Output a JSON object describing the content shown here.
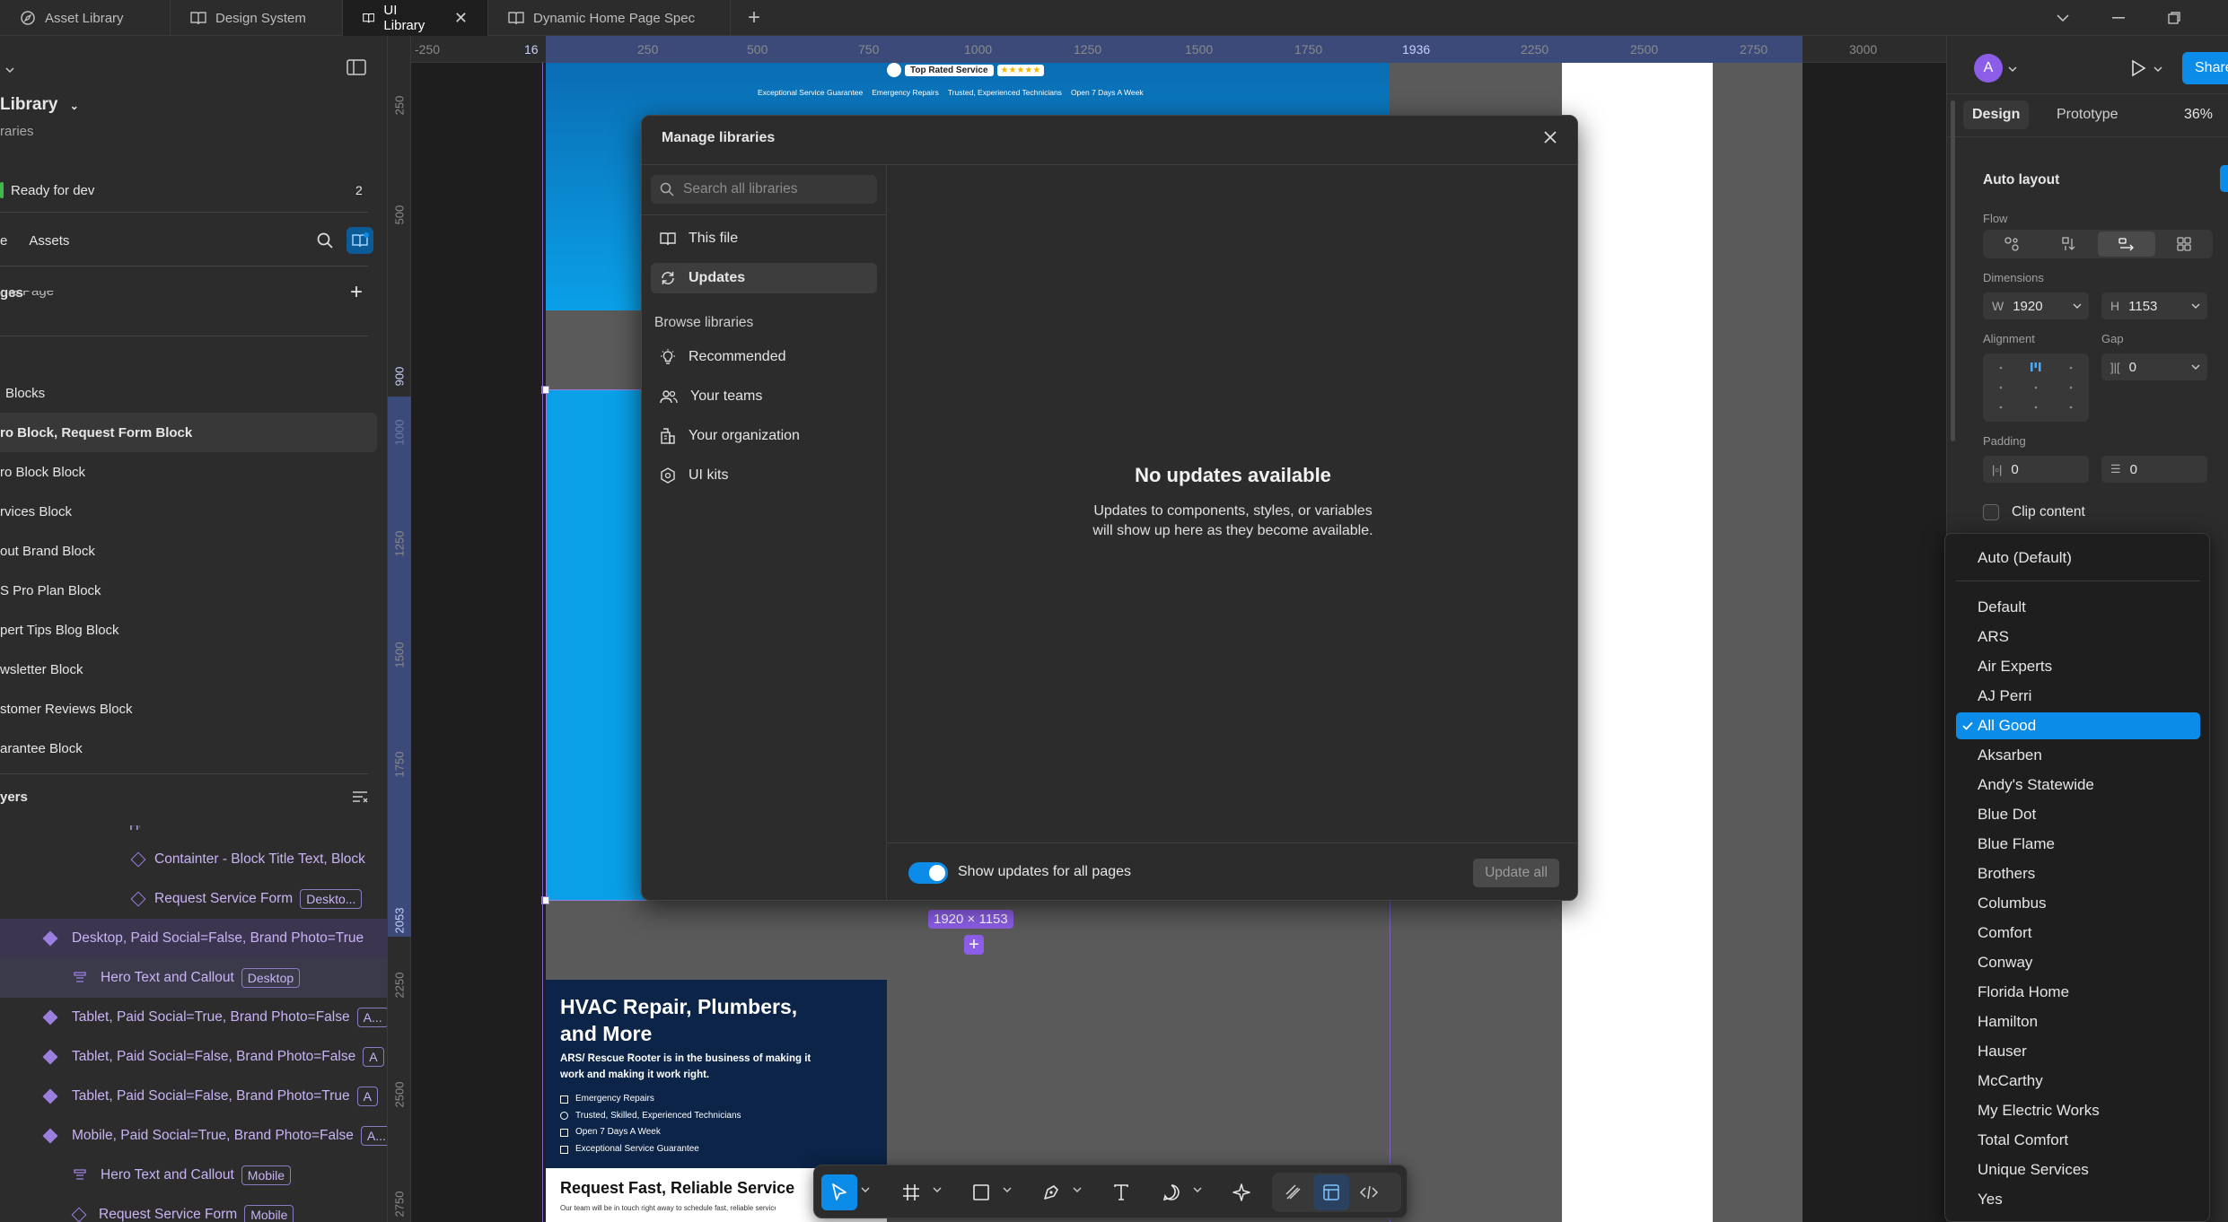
{
  "tabs": [
    {
      "label": "Asset Library",
      "icon": "compass-icon"
    },
    {
      "label": "Design System",
      "icon": "book-icon"
    },
    {
      "label": "UI Library",
      "icon": "book-icon",
      "active": true
    },
    {
      "label": "Dynamic Home Page Spec",
      "icon": "book-icon"
    }
  ],
  "left_panel": {
    "file_title": "Library",
    "file_subtitle": "raries",
    "status": "Ready for dev",
    "status_count": "2",
    "tab_layers": "e",
    "tab_assets": "Assets",
    "pages_header": "ges",
    "pages_partial": "me Page",
    "pages": [
      "Blocks",
      "ro Block, Request Form Block",
      "ro Block Block",
      "rvices Block",
      "out Brand Block",
      "S Pro Plan Block",
      "pert Tips Blog Block",
      "wsletter Block",
      "stomer Reviews Block",
      "arantee Block"
    ],
    "layers_header": "yers",
    "layers_partial": "Hero Block Content",
    "layers": [
      {
        "label": "Containter - Block Title Text, Block",
        "badge": "",
        "kind": "hollow",
        "indent": 1
      },
      {
        "label": "Request Service Form",
        "badge": "Deskto...",
        "kind": "hollow",
        "indent": 1
      },
      {
        "label": "Desktop, Paid Social=False, Brand Photo=True",
        "badge": "",
        "kind": "solid",
        "indent": 0
      },
      {
        "label": "Hero Text and Callout",
        "badge": "Desktop",
        "kind": "stack",
        "indent": 1
      },
      {
        "label": "Tablet, Paid Social=True, Brand Photo=False",
        "badge": "A...",
        "kind": "solid",
        "indent": 0
      },
      {
        "label": "Tablet, Paid Social=False, Brand Photo=False",
        "badge": "A",
        "kind": "solid",
        "indent": 0
      },
      {
        "label": "Tablet, Paid Social=False, Brand Photo=True",
        "badge": "A",
        "kind": "solid",
        "indent": 0
      },
      {
        "label": "Mobile, Paid Social=True, Brand Photo=False",
        "badge": "A...",
        "kind": "solid",
        "indent": 0
      },
      {
        "label": "Hero Text and Callout",
        "badge": "Mobile",
        "kind": "stack",
        "indent": 1
      },
      {
        "label": "Request Service Form",
        "badge": "Mobile",
        "kind": "hollow",
        "indent": 1
      }
    ]
  },
  "ruler": {
    "top": [
      "-250",
      "16",
      "250",
      "500",
      "750",
      "1000",
      "1250",
      "1500",
      "1750",
      "1936",
      "2250",
      "2500",
      "2750",
      "3000"
    ],
    "left": [
      "250",
      "500",
      "900",
      "1000",
      "1250",
      "1500",
      "1750",
      "2053",
      "2250",
      "2500",
      "2750"
    ]
  },
  "canvas": {
    "top_rated": "Top Rated Service",
    "trust_items": [
      "Exceptional Service Guarantee",
      "Emergency Repairs",
      "Trusted, Experienced Technicians",
      "Open 7 Days A Week"
    ],
    "size_label": "1920 × 1153",
    "hero_title": "HVAC Repair, Plumbers, and More",
    "hero_body": "ARS/ Rescue Rooter is in the business of making it work and making it work right.",
    "hero_list": [
      "Emergency Repairs",
      "Trusted, Skilled, Experienced Technicians",
      "Open 7 Days A Week",
      "Exceptional Service Guarantee"
    ],
    "form_title": "Request Fast, Reliable Service",
    "form_sub": "Our team will be in touch right away to schedule fast, reliable service tailored to you"
  },
  "modal": {
    "title": "Manage libraries",
    "search_placeholder": "Search all libraries",
    "nav_this_file": "This file",
    "nav_updates": "Updates",
    "browse_header": "Browse libraries",
    "browse": [
      {
        "label": "Recommended",
        "icon": "lightbulb-icon"
      },
      {
        "label": "Your teams",
        "icon": "people-icon"
      },
      {
        "label": "Your organization",
        "icon": "building-icon"
      },
      {
        "label": "UI kits",
        "icon": "kit-icon"
      }
    ],
    "empty_title": "No updates available",
    "empty_body_1": "Updates to components, styles, or variables",
    "empty_body_2": "will show up here as they become available.",
    "toggle_label": "Show updates for all pages",
    "update_all": "Update all"
  },
  "right_panel": {
    "avatar_letter": "A",
    "share": "Share",
    "tab_design": "Design",
    "tab_prototype": "Prototype",
    "zoom": "36%",
    "auto_layout": "Auto layout",
    "flow_label": "Flow",
    "dimensions_label": "Dimensions",
    "w_label": "W",
    "w_value": "1920",
    "h_label": "H",
    "h_value": "1153",
    "alignment_label": "Alignment",
    "gap_label": "Gap",
    "gap_value": "0",
    "padding_label": "Padding",
    "padding_h": "0",
    "padding_v": "0",
    "clip_content": "Clip content"
  },
  "dropdown": {
    "auto": "Auto (Default)",
    "items": [
      "Default",
      "ARS",
      "Air Experts",
      "AJ Perri",
      "All Good",
      "Aksarben",
      "Andy's Statewide",
      "Blue Dot",
      "Blue Flame",
      "Brothers",
      "Columbus",
      "Comfort",
      "Conway",
      "Florida Home",
      "Hamilton",
      "Hauser",
      "McCarthy",
      "My Electric Works",
      "Total Comfort",
      "Unique Services",
      "Yes"
    ],
    "selected": "All Good"
  },
  "colors": {
    "accent": "#0c8ce9",
    "purple": "#9b7fe0",
    "canvas_blue": "#0aa0e8",
    "hero_navy": "#0b2447"
  }
}
